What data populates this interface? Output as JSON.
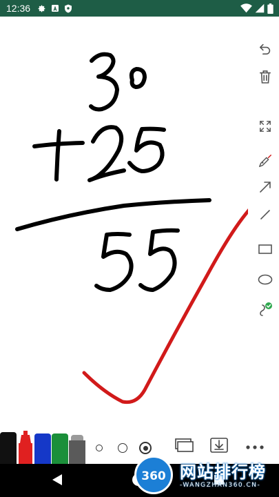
{
  "status_bar": {
    "time": "12:36",
    "left_icons": [
      "gear-icon",
      "a-box-icon",
      "shield-icon"
    ],
    "right_icons": [
      "wifi-icon",
      "signal-icon",
      "battery-icon"
    ],
    "background": "#1e5d46"
  },
  "canvas": {
    "ink_colors": {
      "black": "#000000",
      "red": "#d11a1a"
    }
  },
  "right_toolbar": {
    "tools": [
      "undo-icon",
      "trash-icon",
      "fullscreen-icon",
      "laser-pointer-icon",
      "arrow-icon",
      "line-icon",
      "rectangle-icon",
      "ellipse-icon",
      "freehand-icon"
    ],
    "active_tool": "freehand-icon",
    "active_badge_color": "#2fa84f"
  },
  "bottom_bar": {
    "pens": [
      {
        "name": "black-marker",
        "color": "#111111",
        "selected": false
      },
      {
        "name": "red-marker",
        "color": "#e02020",
        "selected": true
      },
      {
        "name": "blue-marker",
        "color": "#1538c8",
        "selected": false
      },
      {
        "name": "green-marker",
        "color": "#1b8f3a",
        "selected": false
      },
      {
        "name": "gray-marker",
        "color": "#5a5a5a",
        "selected": false
      }
    ],
    "stroke_sizes": [
      "small",
      "medium",
      "large"
    ],
    "selected_size": "large",
    "actions": [
      "pages-icon",
      "download-icon",
      "more-icon"
    ]
  },
  "nav_bar": {
    "buttons": [
      "back-icon",
      "home-icon",
      "recents-icon"
    ]
  },
  "watermark": {
    "logo_text": "360",
    "title": "网站排行榜",
    "subtitle": "-WANGZHAN360.CN-"
  }
}
